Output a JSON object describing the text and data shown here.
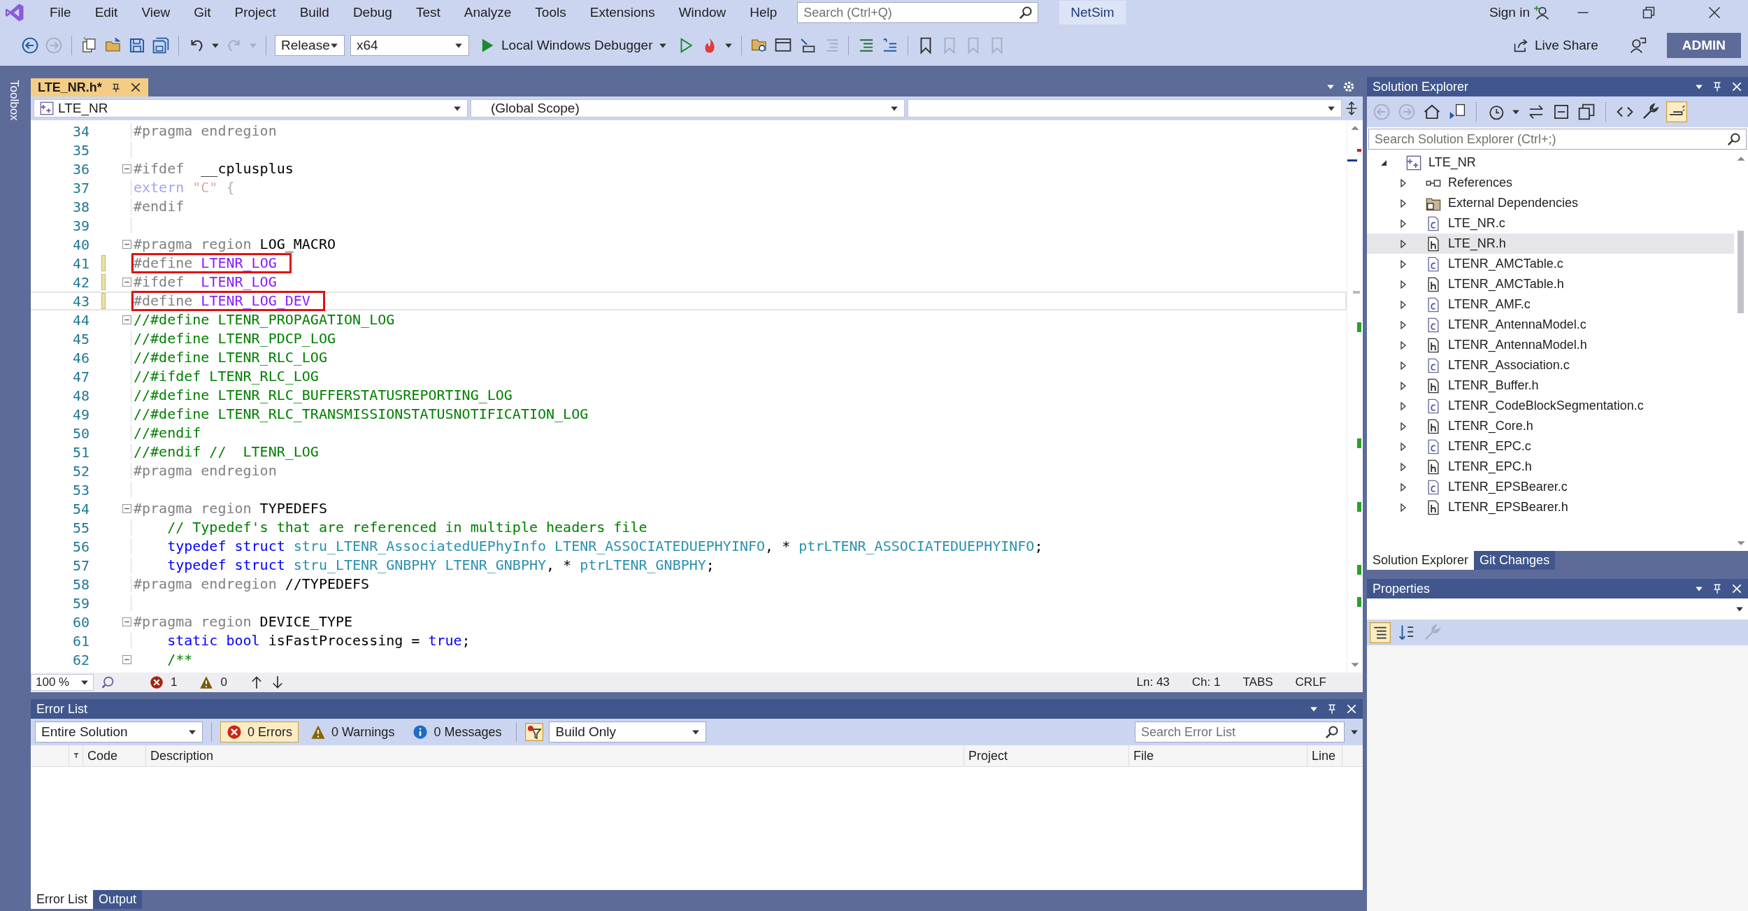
{
  "menu_bar": {
    "items": [
      "File",
      "Edit",
      "View",
      "Git",
      "Project",
      "Build",
      "Debug",
      "Test",
      "Analyze",
      "Tools",
      "Extensions",
      "Window",
      "Help"
    ],
    "search": {
      "placeholder": "Search (Ctrl+Q)"
    },
    "solution_name": "NetSim",
    "sign_in": "Sign in"
  },
  "toolbar": {
    "configuration": "Release",
    "platform": "x64",
    "debugger": "Local Windows Debugger",
    "live_share": "Live Share",
    "user": "ADMIN"
  },
  "toolbox": {
    "label": "Toolbox"
  },
  "editor": {
    "tabs": [
      {
        "label": "LTE_NR.h*",
        "selected": true
      }
    ],
    "navigation": {
      "project": "LTE_NR",
      "scope": "(Global Scope)"
    },
    "lines": [
      {
        "number": "34",
        "collapsible": false,
        "changed": false,
        "boxed": false,
        "current": false,
        "indent": false,
        "tokens": [
          {
            "kind": "pp",
            "text": "#pragma endregion"
          }
        ]
      },
      {
        "number": "35",
        "collapsible": false,
        "changed": false,
        "current": false
      },
      {
        "number": "36",
        "collapsible": true,
        "changed": false,
        "boxed": false,
        "current": false,
        "indent": false,
        "tokens": [
          {
            "kind": "pp",
            "text": "#ifdef"
          },
          {
            "kind": "plain",
            "text": "  __cplusplus"
          }
        ]
      },
      {
        "number": "37",
        "collapsible": false,
        "changed": false,
        "boxed": false,
        "current": false,
        "indent": false,
        "tokens": [
          {
            "kind": "faded-keyword",
            "text": "extern"
          },
          {
            "kind": "faded-string",
            "text": " \"C\""
          },
          {
            "kind": "faded-plain",
            "text": " {"
          }
        ]
      },
      {
        "number": "38",
        "collapsible": false,
        "changed": false,
        "boxed": false,
        "current": false,
        "indent": false,
        "tokens": [
          {
            "kind": "pp",
            "text": "#endif"
          }
        ]
      },
      {
        "number": "39",
        "collapsible": false,
        "changed": false,
        "current": false
      },
      {
        "number": "40",
        "collapsible": true,
        "changed": false,
        "boxed": false,
        "current": false,
        "indent": false,
        "tokens": [
          {
            "kind": "pp",
            "text": "#pragma region"
          },
          {
            "kind": "plain",
            "text": " LOG_MACRO"
          }
        ]
      },
      {
        "number": "41",
        "collapsible": false,
        "changed": true,
        "boxed": true,
        "current": false,
        "indent": false,
        "tokens": [
          {
            "kind": "pp",
            "text": "#define"
          },
          {
            "kind": "macro",
            "text": " LTENR_LOG"
          }
        ]
      },
      {
        "number": "42",
        "collapsible": true,
        "changed": true,
        "boxed": false,
        "current": false,
        "indent": false,
        "tokens": [
          {
            "kind": "pp",
            "text": "#ifdef"
          },
          {
            "kind": "macro",
            "text": "  LTENR_LOG"
          }
        ]
      },
      {
        "number": "43",
        "collapsible": false,
        "changed": true,
        "boxed": true,
        "current": true,
        "indent": false,
        "tokens": [
          {
            "kind": "pp",
            "text": "#define"
          },
          {
            "kind": "macro",
            "text": " LTENR_LOG_DEV"
          }
        ]
      },
      {
        "number": "44",
        "collapsible": true,
        "changed": false,
        "boxed": false,
        "current": false,
        "indent": false,
        "tokens": [
          {
            "kind": "comment",
            "text": "//#define LTENR_PROPAGATION_LOG"
          }
        ]
      },
      {
        "number": "45",
        "collapsible": false,
        "changed": false,
        "boxed": false,
        "current": false,
        "indent": false,
        "tokens": [
          {
            "kind": "comment",
            "text": "//#define LTENR_PDCP_LOG"
          }
        ]
      },
      {
        "number": "46",
        "collapsible": false,
        "changed": false,
        "boxed": false,
        "current": false,
        "indent": false,
        "tokens": [
          {
            "kind": "comment",
            "text": "//#define LTENR_RLC_LOG"
          }
        ]
      },
      {
        "number": "47",
        "collapsible": false,
        "changed": false,
        "boxed": false,
        "current": false,
        "indent": false,
        "tokens": [
          {
            "kind": "comment",
            "text": "//#ifdef LTENR_RLC_LOG"
          }
        ]
      },
      {
        "number": "48",
        "collapsible": false,
        "changed": false,
        "boxed": false,
        "current": false,
        "indent": false,
        "tokens": [
          {
            "kind": "comment",
            "text": "//#define LTENR_RLC_BUFFERSTATUSREPORTING_LOG"
          }
        ]
      },
      {
        "number": "49",
        "collapsible": false,
        "changed": false,
        "boxed": false,
        "current": false,
        "indent": false,
        "tokens": [
          {
            "kind": "comment",
            "text": "//#define LTENR_RLC_TRANSMISSIONSTATUSNOTIFICATION_LOG"
          }
        ]
      },
      {
        "number": "50",
        "collapsible": false,
        "changed": false,
        "boxed": false,
        "current": false,
        "indent": false,
        "tokens": [
          {
            "kind": "comment",
            "text": "//#endif"
          }
        ]
      },
      {
        "number": "51",
        "collapsible": false,
        "changed": false,
        "boxed": false,
        "current": false,
        "indent": false,
        "tokens": [
          {
            "kind": "comment",
            "text": "//#endif //  LTENR_LOG"
          }
        ]
      },
      {
        "number": "52",
        "collapsible": false,
        "changed": false,
        "boxed": false,
        "current": false,
        "indent": false,
        "tokens": [
          {
            "kind": "pp",
            "text": "#pragma endregion"
          }
        ]
      },
      {
        "number": "53",
        "collapsible": false,
        "changed": false,
        "current": false
      },
      {
        "number": "54",
        "collapsible": true,
        "changed": false,
        "boxed": false,
        "current": false,
        "indent": false,
        "tokens": [
          {
            "kind": "pp",
            "text": "#pragma region"
          },
          {
            "kind": "plain",
            "text": " TYPEDEFS"
          }
        ]
      },
      {
        "number": "55",
        "collapsible": false,
        "changed": false,
        "boxed": false,
        "current": false,
        "indent": true,
        "tokens": [
          {
            "kind": "comment",
            "text": "// Typedef's that are referenced in multiple headers file"
          }
        ]
      },
      {
        "number": "56",
        "collapsible": false,
        "changed": false,
        "boxed": false,
        "current": false,
        "indent": true,
        "tokens": [
          {
            "kind": "keyword",
            "text": "typedef struct"
          },
          {
            "kind": "type",
            "text": " stru_LTENR_AssociatedUEPhyInfo LTENR_ASSOCIATEDUEPHYINFO"
          },
          {
            "kind": "plain",
            "text": ", * "
          },
          {
            "kind": "type",
            "text": "ptrLTENR_ASSOCIATEDUEPHYINFO"
          },
          {
            "kind": "plain",
            "text": ";"
          }
        ]
      },
      {
        "number": "57",
        "collapsible": false,
        "changed": false,
        "boxed": false,
        "current": false,
        "indent": true,
        "tokens": [
          {
            "kind": "keyword",
            "text": "typedef struct"
          },
          {
            "kind": "type",
            "text": " stru_LTENR_GNBPHY LTENR_GNBPHY"
          },
          {
            "kind": "plain",
            "text": ", * "
          },
          {
            "kind": "type",
            "text": "ptrLTENR_GNBPHY"
          },
          {
            "kind": "plain",
            "text": ";"
          }
        ]
      },
      {
        "number": "58",
        "collapsible": false,
        "changed": false,
        "boxed": false,
        "current": false,
        "indent": false,
        "tokens": [
          {
            "kind": "pp",
            "text": "#pragma endregion"
          },
          {
            "kind": "plain",
            "text": " //TYPEDEFS"
          }
        ]
      },
      {
        "number": "59",
        "collapsible": false,
        "changed": false,
        "current": false
      },
      {
        "number": "60",
        "collapsible": true,
        "changed": false,
        "boxed": false,
        "current": false,
        "indent": false,
        "tokens": [
          {
            "kind": "pp",
            "text": "#pragma region"
          },
          {
            "kind": "plain",
            "text": " DEVICE_TYPE"
          }
        ]
      },
      {
        "number": "61",
        "collapsible": false,
        "changed": false,
        "boxed": false,
        "current": false,
        "indent": true,
        "tokens": [
          {
            "kind": "keyword",
            "text": "static bool"
          },
          {
            "kind": "plain",
            "text": " isFastProcessing = "
          },
          {
            "kind": "keyword",
            "text": "true"
          },
          {
            "kind": "plain",
            "text": ";"
          }
        ]
      },
      {
        "number": "62",
        "collapsible": true,
        "changed": false,
        "boxed": false,
        "current": false,
        "indent": true,
        "tokens": [
          {
            "kind": "comment",
            "text": "/**"
          }
        ]
      }
    ],
    "status": {
      "zoom": "100 %",
      "errors": "1",
      "warnings": "0",
      "line": "Ln: 43",
      "column": "Ch: 1",
      "indent": "TABS",
      "line_ending": "CRLF"
    }
  },
  "solution_explorer": {
    "title": "Solution Explorer",
    "search": {
      "placeholder": "Search Solution Explorer (Ctrl+;)"
    },
    "tree": [
      {
        "label": "LTE_NR",
        "kind": "project",
        "expanded": true,
        "selected": false,
        "children": [
          {
            "label": "References",
            "kind": "references",
            "expanded": false,
            "selected": false
          },
          {
            "label": "External Dependencies",
            "kind": "folder",
            "expanded": false,
            "selected": false
          },
          {
            "label": "LTE_NR.c",
            "kind": "source",
            "expanded": false,
            "selected": false
          },
          {
            "label": "LTE_NR.h",
            "kind": "header",
            "expanded": false,
            "selected": true
          },
          {
            "label": "LTENR_AMCTable.c",
            "kind": "source",
            "expanded": false,
            "selected": false
          },
          {
            "label": "LTENR_AMCTable.h",
            "kind": "header",
            "expanded": false,
            "selected": false
          },
          {
            "label": "LTENR_AMF.c",
            "kind": "source",
            "expanded": false,
            "selected": false
          },
          {
            "label": "LTENR_AntennaModel.c",
            "kind": "source",
            "expanded": false,
            "selected": false
          },
          {
            "label": "LTENR_AntennaModel.h",
            "kind": "header",
            "expanded": false,
            "selected": false
          },
          {
            "label": "LTENR_Association.c",
            "kind": "source",
            "expanded": false,
            "selected": false
          },
          {
            "label": "LTENR_Buffer.h",
            "kind": "header",
            "expanded": false,
            "selected": false
          },
          {
            "label": "LTENR_CodeBlockSegmentation.c",
            "kind": "source",
            "expanded": false,
            "selected": false
          },
          {
            "label": "LTENR_Core.h",
            "kind": "header",
            "expanded": false,
            "selected": false
          },
          {
            "label": "LTENR_EPC.c",
            "kind": "source",
            "expanded": false,
            "selected": false
          },
          {
            "label": "LTENR_EPC.h",
            "kind": "header",
            "expanded": false,
            "selected": false
          },
          {
            "label": "LTENR_EPSBearer.c",
            "kind": "source",
            "expanded": false,
            "selected": false
          },
          {
            "label": "LTENR_EPSBearer.h",
            "kind": "header",
            "expanded": false,
            "selected": false
          }
        ]
      }
    ],
    "tabs": [
      {
        "label": "Solution Explorer",
        "selected": true
      },
      {
        "label": "Git Changes",
        "selected": false
      }
    ]
  },
  "properties": {
    "title": "Properties"
  },
  "error_list": {
    "title": "Error List",
    "scope": "Entire Solution",
    "filters": [
      {
        "label": "0 Errors",
        "kind": "error",
        "selected": true
      },
      {
        "label": "0 Warnings",
        "kind": "warning",
        "selected": false
      },
      {
        "label": "0 Messages",
        "kind": "info",
        "selected": false
      }
    ],
    "build_filter": "Build Only",
    "search": {
      "placeholder": "Search Error List"
    },
    "columns": [
      "Code",
      "Description",
      "Project",
      "File",
      "Line"
    ],
    "tabs": [
      {
        "label": "Error List",
        "selected": true
      },
      {
        "label": "Output",
        "selected": false
      }
    ]
  }
}
